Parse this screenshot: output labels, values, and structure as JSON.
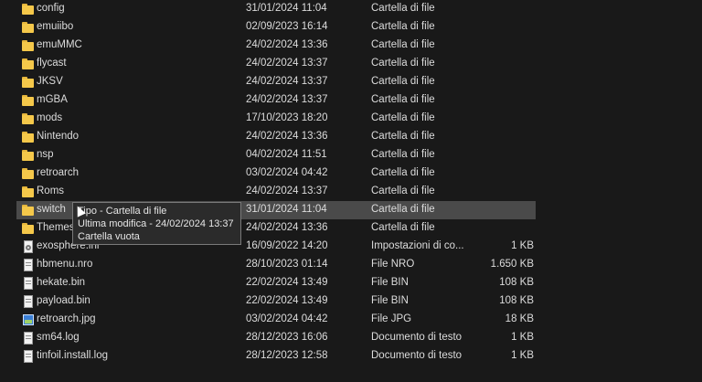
{
  "files": [
    {
      "name": "config",
      "date": "31/01/2024 11:04",
      "type": "Cartella di file",
      "size": "",
      "icon": "folder-icon"
    },
    {
      "name": "emuiibo",
      "date": "02/09/2023 16:14",
      "type": "Cartella di file",
      "size": "",
      "icon": "folder-icon"
    },
    {
      "name": "emuMMC",
      "date": "24/02/2024 13:36",
      "type": "Cartella di file",
      "size": "",
      "icon": "folder-icon"
    },
    {
      "name": "flycast",
      "date": "24/02/2024 13:37",
      "type": "Cartella di file",
      "size": "",
      "icon": "folder-icon"
    },
    {
      "name": "JKSV",
      "date": "24/02/2024 13:37",
      "type": "Cartella di file",
      "size": "",
      "icon": "folder-icon"
    },
    {
      "name": "mGBA",
      "date": "24/02/2024 13:37",
      "type": "Cartella di file",
      "size": "",
      "icon": "folder-icon"
    },
    {
      "name": "mods",
      "date": "17/10/2023 18:20",
      "type": "Cartella di file",
      "size": "",
      "icon": "folder-icon"
    },
    {
      "name": "Nintendo",
      "date": "24/02/2024 13:36",
      "type": "Cartella di file",
      "size": "",
      "icon": "folder-icon"
    },
    {
      "name": "nsp",
      "date": "04/02/2024 11:51",
      "type": "Cartella di file",
      "size": "",
      "icon": "folder-icon"
    },
    {
      "name": "retroarch",
      "date": "03/02/2024 04:42",
      "type": "Cartella di file",
      "size": "",
      "icon": "folder-icon"
    },
    {
      "name": "Roms",
      "date": "24/02/2024 13:37",
      "type": "Cartella di file",
      "size": "",
      "icon": "folder-icon"
    },
    {
      "name": "switch",
      "date": "31/01/2024 11:04",
      "type": "Cartella di file",
      "size": "",
      "icon": "folder-icon"
    },
    {
      "name": "Themes",
      "date": "24/02/2024 13:36",
      "type": "Cartella di file",
      "size": "",
      "icon": "folder-icon"
    },
    {
      "name": "exosphere.ini",
      "date": "16/09/2022 14:20",
      "type": "Impostazioni di co...",
      "size": "1 KB",
      "icon": "settings-file-icon"
    },
    {
      "name": "hbmenu.nro",
      "date": "28/10/2023 01:14",
      "type": "File NRO",
      "size": "1.650 KB",
      "icon": "file-icon"
    },
    {
      "name": "hekate.bin",
      "date": "22/02/2024 13:49",
      "type": "File BIN",
      "size": "108 KB",
      "icon": "file-icon"
    },
    {
      "name": "payload.bin",
      "date": "22/02/2024 13:49",
      "type": "File BIN",
      "size": "108 KB",
      "icon": "file-icon"
    },
    {
      "name": "retroarch.jpg",
      "date": "03/02/2024 04:42",
      "type": "File JPG",
      "size": "18 KB",
      "icon": "image-file-icon"
    },
    {
      "name": "sm64.log",
      "date": "28/12/2023 16:06",
      "type": "Documento di testo",
      "size": "1 KB",
      "icon": "file-icon"
    },
    {
      "name": "tinfoil.install.log",
      "date": "28/12/2023 12:58",
      "type": "Documento di testo",
      "size": "1 KB",
      "icon": "file-icon"
    }
  ],
  "hovered_index": 11,
  "tooltip": {
    "line1": "Tipo - Cartella di file",
    "line2": "Ultima modifica - 24/02/2024 13:37",
    "line3": "Cartella vuota"
  }
}
